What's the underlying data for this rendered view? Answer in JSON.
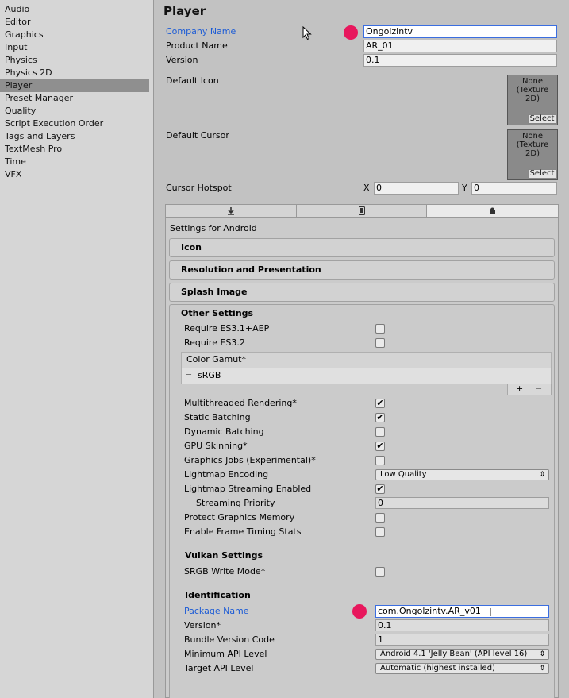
{
  "sidebar": {
    "items": [
      {
        "label": "Audio",
        "selected": false
      },
      {
        "label": "Editor",
        "selected": false
      },
      {
        "label": "Graphics",
        "selected": false
      },
      {
        "label": "Input",
        "selected": false
      },
      {
        "label": "Physics",
        "selected": false
      },
      {
        "label": "Physics 2D",
        "selected": false
      },
      {
        "label": "Player",
        "selected": true
      },
      {
        "label": "Preset Manager",
        "selected": false
      },
      {
        "label": "Quality",
        "selected": false
      },
      {
        "label": "Script Execution Order",
        "selected": false
      },
      {
        "label": "Tags and Layers",
        "selected": false
      },
      {
        "label": "TextMesh Pro",
        "selected": false
      },
      {
        "label": "Time",
        "selected": false
      },
      {
        "label": "VFX",
        "selected": false
      }
    ]
  },
  "player": {
    "title": "Player",
    "company_name_label": "Company Name",
    "company_name_value": "Ongolzintv",
    "product_name_label": "Product Name",
    "product_name_value": "AR_01",
    "version_label": "Version",
    "version_value": "0.1",
    "default_icon_label": "Default Icon",
    "default_cursor_label": "Default Cursor",
    "texture_none": "None",
    "texture_type": "(Texture",
    "texture_dim": "2D)",
    "select_label": "Select",
    "cursor_hotspot_label": "Cursor Hotspot",
    "hotspot_x_label": "X",
    "hotspot_x_value": "0",
    "hotspot_y_label": "Y",
    "hotspot_y_value": "0"
  },
  "platform_tabs": [
    {
      "icon": "download-icon",
      "active": false
    },
    {
      "icon": "phone-icon",
      "active": false
    },
    {
      "icon": "android-icon",
      "active": true
    }
  ],
  "android": {
    "settings_title": "Settings for Android",
    "foldouts": [
      "Icon",
      "Resolution and Presentation",
      "Splash Image"
    ],
    "other_settings_title": "Other Settings",
    "require_es31_label": "Require ES3.1+AEP",
    "require_es31_checked": false,
    "require_es32_label": "Require ES3.2",
    "require_es32_checked": false,
    "color_gamut_label": "Color Gamut*",
    "color_gamut_item": "sRGB",
    "gamut_add": "+",
    "gamut_remove": "−",
    "multithreaded_label": "Multithreaded Rendering*",
    "multithreaded_checked": true,
    "static_batching_label": "Static Batching",
    "static_batching_checked": true,
    "dynamic_batching_label": "Dynamic Batching",
    "dynamic_batching_checked": false,
    "gpu_skinning_label": "GPU Skinning*",
    "gpu_skinning_checked": true,
    "graphics_jobs_label": "Graphics Jobs (Experimental)*",
    "graphics_jobs_checked": false,
    "lightmap_encoding_label": "Lightmap Encoding",
    "lightmap_encoding_value": "Low Quality",
    "lightmap_streaming_label": "Lightmap Streaming Enabled",
    "lightmap_streaming_checked": true,
    "streaming_priority_label": "Streaming Priority",
    "streaming_priority_value": "0",
    "protect_memory_label": "Protect Graphics Memory",
    "protect_memory_checked": false,
    "frame_timing_label": "Enable Frame Timing Stats",
    "frame_timing_checked": false,
    "vulkan_title": "Vulkan Settings",
    "srgb_write_label": "SRGB Write Mode*",
    "srgb_write_checked": false,
    "identification_title": "Identification",
    "package_name_label": "Package Name",
    "package_name_value": "com.Ongolzintv.AR_v01",
    "version_label": "Version*",
    "version_value": "0.1",
    "bundle_code_label": "Bundle Version Code",
    "bundle_code_value": "1",
    "min_api_label": "Minimum API Level",
    "min_api_value": "Android 4.1 'Jelly Bean' (API level 16)",
    "target_api_label": "Target API Level",
    "target_api_value": "Automatic (highest installed)"
  },
  "colors": {
    "accent_blue": "#1b5bd6",
    "marker_red": "#e8175d",
    "selection_gray": "#8f8f8f"
  }
}
